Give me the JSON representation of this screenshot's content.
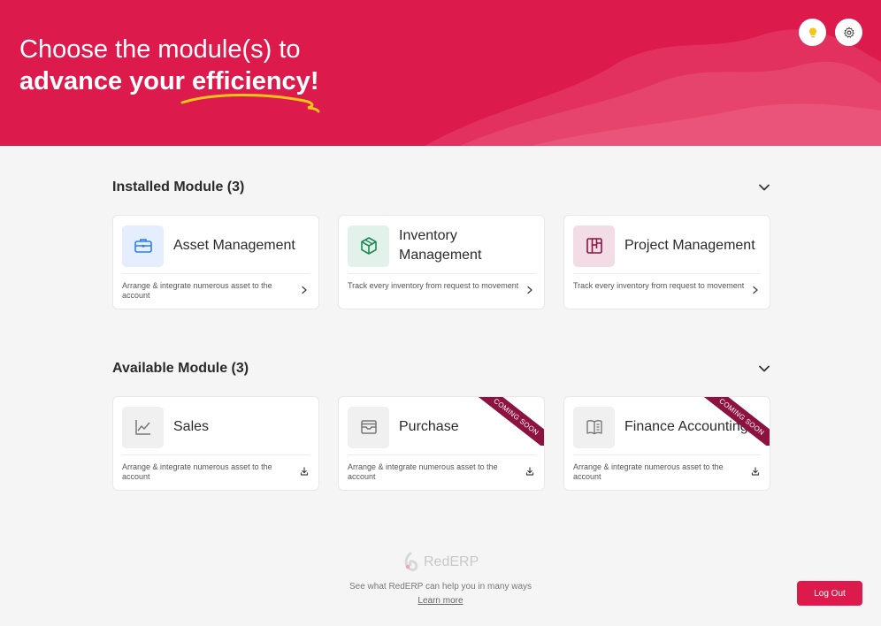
{
  "hero": {
    "title_line1": "Choose the module(s) to",
    "title_line2": "advance your efficiency!",
    "bg_color": "#dc1a4b",
    "buttons": [
      {
        "icon": "lightbulb-icon"
      },
      {
        "icon": "gear-icon"
      }
    ]
  },
  "installed": {
    "title": "Installed Module (3)",
    "modules": [
      {
        "name": "Asset Management",
        "description": "Arrange & integrate numerous asset to the account",
        "icon": "briefcase-icon",
        "action_icon": "chevron-right-icon"
      },
      {
        "name": "Inventory Management",
        "description": "Track every inventory from request to movement",
        "icon": "box-icon",
        "action_icon": "chevron-right-icon"
      },
      {
        "name": "Project Management",
        "description": "Track every inventory from request to movement",
        "icon": "kanban-icon",
        "action_icon": "chevron-right-icon"
      }
    ]
  },
  "available": {
    "title": "Available Module (3)",
    "modules": [
      {
        "name": "Sales",
        "description": "Arrange & integrate numerous asset to the account",
        "icon": "chart-icon",
        "action_icon": "download-icon"
      },
      {
        "name": "Purchase",
        "description": "Arrange & integrate numerous asset to the account",
        "icon": "inbox-icon",
        "action_icon": "download-icon",
        "ribbon": "COMING SOON"
      },
      {
        "name": "Finance Accounting",
        "description": "Arrange & integrate numerous asset to the account",
        "icon": "book-icon",
        "action_icon": "download-icon",
        "ribbon": "COMING SOON"
      }
    ]
  },
  "footer": {
    "brand": "RedERP",
    "tagline": "See what RedERP can help you in many ways",
    "link": "Learn more"
  },
  "logout_label": "Log Out",
  "colors": {
    "accent": "#dc1a4b",
    "ribbon": "#8c1240"
  }
}
